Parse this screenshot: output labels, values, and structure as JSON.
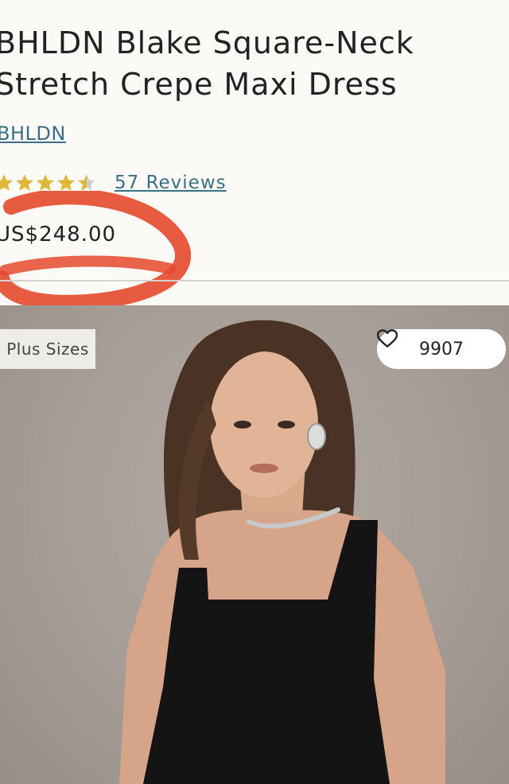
{
  "product": {
    "title_line1": "BHLDN Blake Square-Neck",
    "title_line2": "Stretch Crepe Maxi Dress",
    "brand": "BHLDN",
    "rating": {
      "value": 4.5,
      "max": 5,
      "reviews_label": "57 Reviews"
    },
    "price": "US$248.00"
  },
  "image": {
    "badge": "Plus Sizes",
    "favorites_count": "9907",
    "icons": {
      "favorite": "heart-outline-icon",
      "star": "star-icon"
    }
  },
  "colors": {
    "link": "#3a6f86",
    "star": "#e0b83a",
    "annotation": "#e4492b"
  }
}
